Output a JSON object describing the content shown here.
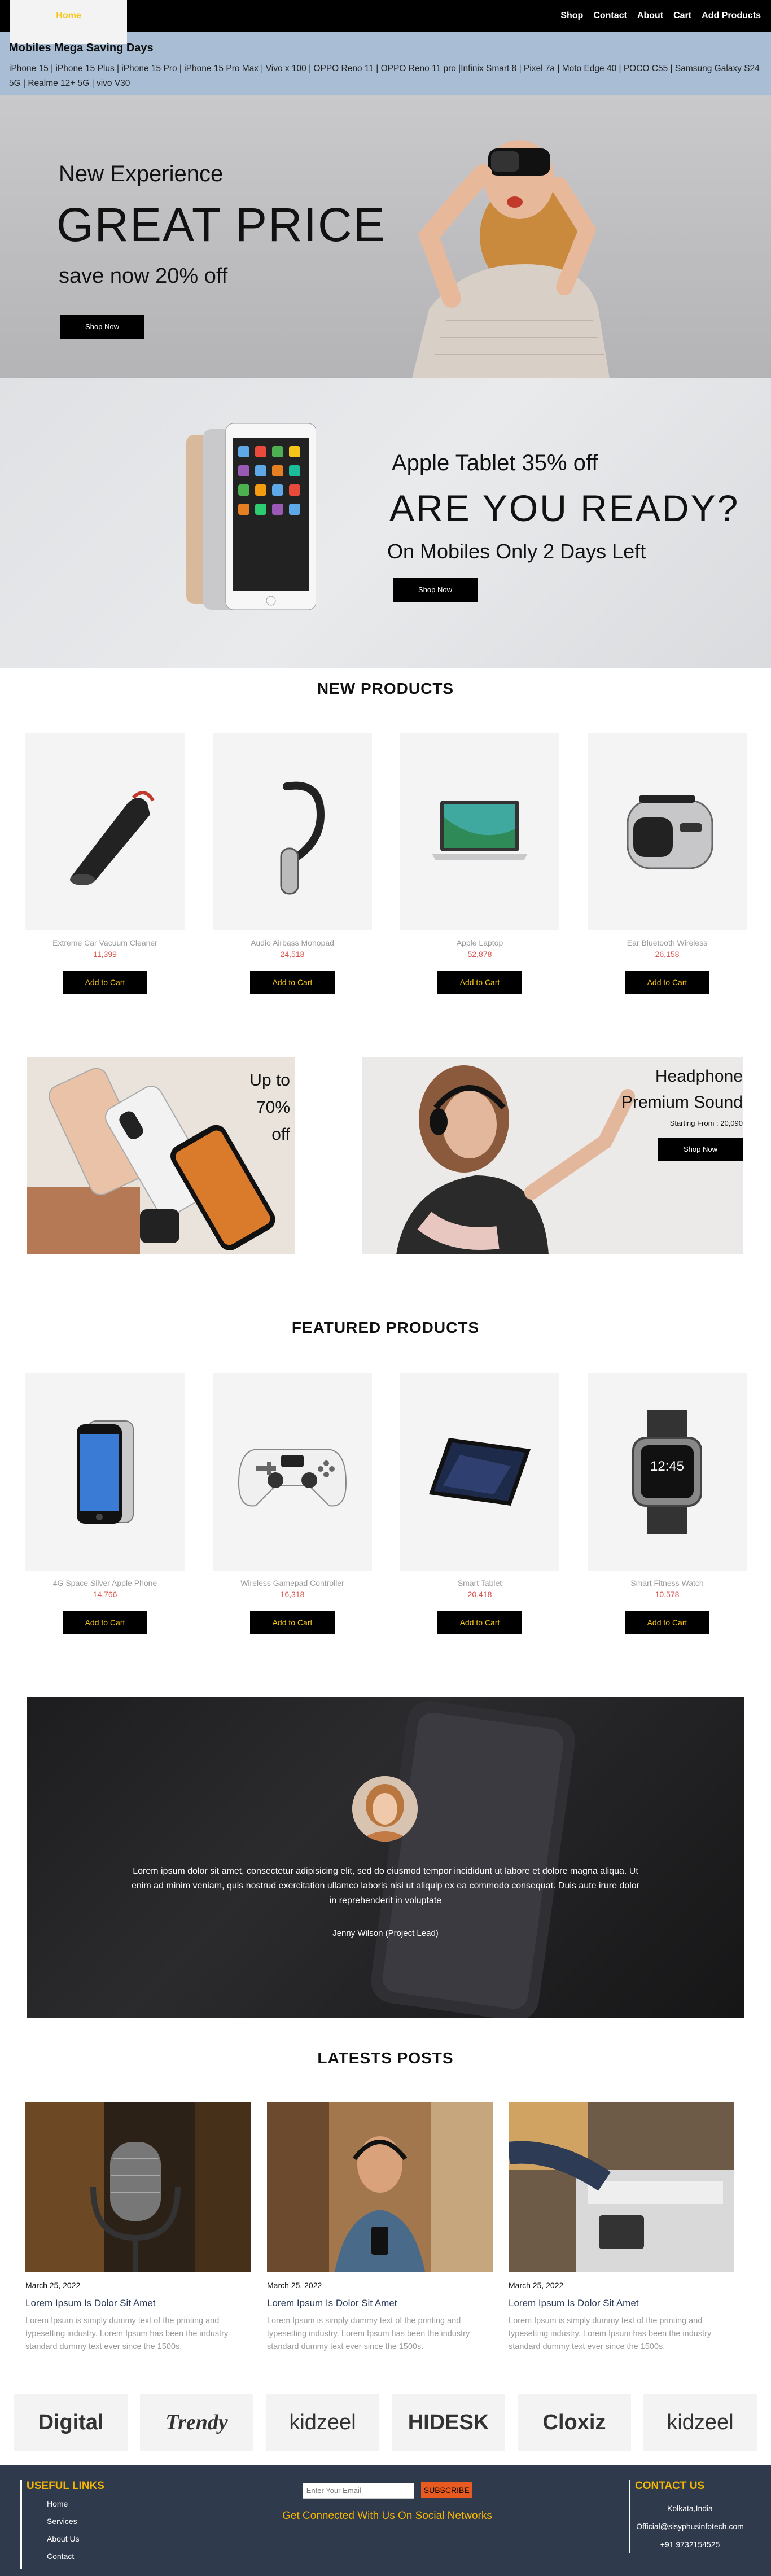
{
  "nav": {
    "brand": "Home",
    "links": [
      "Shop",
      "Contact",
      "About",
      "Cart",
      "Add Products"
    ]
  },
  "mega": {
    "title": "Mobiles Mega Saving Days",
    "list": "iPhone 15 | iPhone 15 Plus | iPhone 15 Pro | iPhone 15 Pro Max | Vivo x 100 | OPPO Reno 11 | OPPO Reno 11 pro |Infinix Smart 8 | Pixel 7a | Moto Edge 40 | POCO C55 | Samsung Galaxy S24 5G | Realme 12+ 5G | vivo V30"
  },
  "hero1": {
    "subtitle": "New Experience",
    "headline": "GREAT PRICE",
    "offer": "save now 20% off",
    "button": "Shop Now"
  },
  "hero2": {
    "subtitle": "Apple Tablet 35% off",
    "headline": "ARE YOU READY?",
    "offer": "On Mobiles Only 2 Days Left",
    "button": "Shop Now"
  },
  "new_products": {
    "title": "NEW PRODUCTS",
    "items": [
      {
        "name": "Extreme Car Vacuum Cleaner",
        "price": "11,399",
        "button": "Add to Cart"
      },
      {
        "name": "Audio Airbass Monopad",
        "price": "24,518",
        "button": "Add to Cart"
      },
      {
        "name": "Apple Laptop",
        "price": "52,878",
        "button": "Add to Cart"
      },
      {
        "name": "Ear Bluetooth Wireless",
        "price": "26,158",
        "button": "Add to Cart"
      }
    ]
  },
  "promo": {
    "left_line1": "Up to",
    "left_line2": "70%",
    "left_line3": "off",
    "right_line1": "Headphone",
    "right_line2": "Premium Sound",
    "right_small": "Starting From : 20,090",
    "right_button": "Shop Now"
  },
  "featured_products": {
    "title": "FEATURED PRODUCTS",
    "items": [
      {
        "name": "4G Space Silver Apple Phone",
        "price": "14,766",
        "button": "Add to Cart"
      },
      {
        "name": "Wireless Gamepad Controller",
        "price": "16,318",
        "button": "Add to Cart"
      },
      {
        "name": "Smart Tablet",
        "price": "20,418",
        "button": "Add to Cart"
      },
      {
        "name": "Smart Fitness Watch",
        "price": "10,578",
        "button": "Add to Cart"
      }
    ]
  },
  "testimonial": {
    "quote": "Lorem ipsum dolor sit amet, consectetur adipisicing elit, sed do eiusmod tempor incididunt ut labore et dolore magna aliqua. Ut enim ad minim veniam, quis nostrud exercitation ullamco laboris nisi ut aliquip ex ea commodo consequat. Duis aute irure dolor in reprehenderit in voluptate",
    "author": "Jenny Wilson (Project Lead)"
  },
  "posts": {
    "title": "LATESTS POSTS",
    "items": [
      {
        "date": "March 25, 2022",
        "title": "Lorem Ipsum Is Dolor Sit Amet",
        "text": "Lorem Ipsum is simply dummy text of the printing and typesetting industry. Lorem Ipsum has been the industry standard dummy text ever since the 1500s."
      },
      {
        "date": "March 25, 2022",
        "title": "Lorem Ipsum Is Dolor Sit Amet",
        "text": "Lorem Ipsum is simply dummy text of the printing and typesetting industry. Lorem Ipsum has been the industry standard dummy text ever since the 1500s."
      },
      {
        "date": "March 25, 2022",
        "title": "Lorem Ipsum Is Dolor Sit Amet",
        "text": "Lorem Ipsum is simply dummy text of the printing and typesetting industry. Lorem Ipsum has been the industry standard dummy text ever since the 1500s."
      }
    ]
  },
  "brands": [
    "Digital",
    "Trendy",
    "kidzeel",
    "HIDESK",
    "Cloxiz",
    "kidzeel"
  ],
  "footer": {
    "links_title": "USEFUL LINKS",
    "links": [
      "Home",
      "Services",
      "About Us",
      "Contact"
    ],
    "email_placeholder": "Enter Your Email",
    "subscribe": "SUBSCRIBE",
    "social": "Get Connected With Us On Social Networks",
    "contact_title": "CONTACT US",
    "location": "Kolkata,India",
    "email": "Official@sisyphusinfotech.com",
    "phone": "+91 9732154525"
  },
  "colors": {
    "accent": "#f5c518",
    "price": "#d9534f",
    "footer_bg": "#2f3a4d",
    "subscribe": "#e85a1f"
  }
}
